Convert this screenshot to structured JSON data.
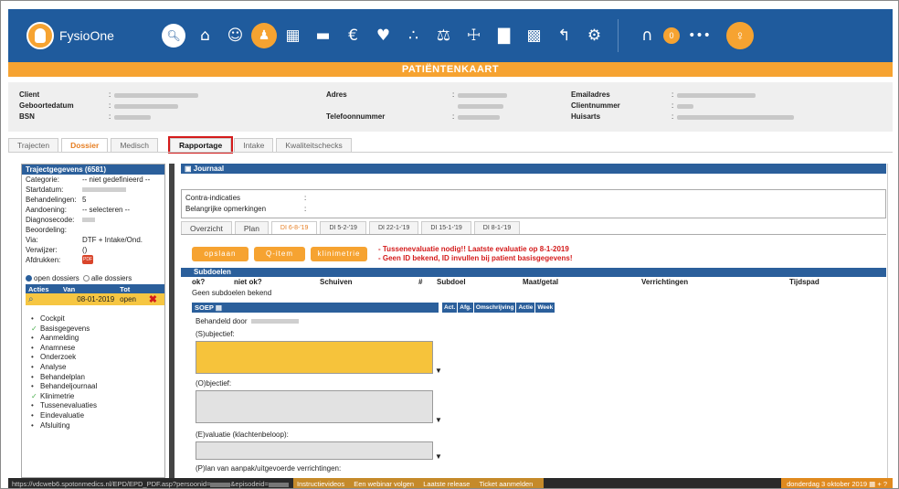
{
  "app": {
    "name": "FysioOne"
  },
  "nav": {
    "icons": [
      "home-icon",
      "client-icon",
      "group-icon",
      "calendar-icon",
      "card-icon",
      "finance-icon",
      "handshake-icon",
      "runner-icon",
      "balance-icon",
      "network-icon",
      "stats-icon",
      "report-icon",
      "back-icon",
      "settings-icon"
    ],
    "support_count": "0",
    "more": "•••"
  },
  "page": {
    "title": "PATIËNTENKAART"
  },
  "patient": {
    "labels": {
      "client": "Client",
      "birthdate": "Geboortedatum",
      "bsn": "BSN",
      "address": "Adres",
      "phone": "Telefoonnummer",
      "email": "Emailadres",
      "client_number": "Clientnummer",
      "gp": "Huisarts"
    }
  },
  "tabs": [
    "Trajecten",
    "Dossier",
    "Medisch",
    "Rapportage",
    "Intake",
    "Kwaliteitschecks"
  ],
  "left": {
    "header": "Trajectgegevens (6581)",
    "rows": [
      {
        "k": "Categorie:",
        "v": "-- niet gedefinieerd --"
      },
      {
        "k": "Startdatum:",
        "v": ""
      },
      {
        "k": "Behandelingen:",
        "v": "5"
      },
      {
        "k": "Aandoening:",
        "v": "-- selecteren --"
      },
      {
        "k": "Diagnosecode:",
        "v": ""
      },
      {
        "k": "Beoordeling:",
        "v": ""
      },
      {
        "k": "Via:",
        "v": "DTF + Intake/Ond."
      },
      {
        "k": "Verwijzer:",
        "v": "()"
      },
      {
        "k": "Afdrukken:",
        "v": ""
      }
    ],
    "pdf_label": "PDF",
    "radio_open": "open dossiers",
    "radio_all": "alle dossiers",
    "table_headers": [
      "Acties",
      "Van",
      "Tot"
    ],
    "table_row": {
      "from": "08-01-2019",
      "to": "open"
    },
    "menu": [
      {
        "label": "Cockpit",
        "check": false
      },
      {
        "label": "Basisgegevens",
        "check": true
      },
      {
        "label": "Aanmelding",
        "check": false
      },
      {
        "label": "Anamnese",
        "check": false
      },
      {
        "label": "Onderzoek",
        "check": false
      },
      {
        "label": "Analyse",
        "check": false
      },
      {
        "label": "Behandelplan",
        "check": false
      },
      {
        "label": "Behandeljournaal",
        "check": false
      },
      {
        "label": "Klinimetrie",
        "check": true
      },
      {
        "label": "Tussenevaluaties",
        "check": false
      },
      {
        "label": "Eindevaluatie",
        "check": false
      },
      {
        "label": "Afsluiting",
        "check": false
      }
    ]
  },
  "journal": {
    "header": "Journaal",
    "contra": "Contra-indicaties",
    "remarks": "Belangrijke opmerkingen",
    "subtabs": [
      "Overzicht",
      "Plan",
      "DI 6-8-'19",
      "DI 5-2-'19",
      "DI 22-1-'19",
      "DI 15-1-'19",
      "DI 8-1-'19"
    ],
    "buttons": [
      "opslaan",
      "Q-item",
      "klinimetrie"
    ],
    "warning1": "- Tussenevaluatie nodig!! Laatste evaluatie op 8-1-2019",
    "warning2": "- Geen ID bekend, ID invullen bij patient basisgegevens!",
    "subgoals_header": "Subdoelen",
    "subgoal_cols": [
      "ok?",
      "niet ok?",
      "Schuiven",
      "#",
      "Subdoel",
      "Maat/getal",
      "Verrichtingen",
      "Tijdspad"
    ],
    "no_subgoals": "Geen subdoelen bekend",
    "soep_header": "SOEP",
    "soep_cols": [
      "Act.",
      "Afg.",
      "Omschrijving",
      "Actie",
      "Week"
    ],
    "treated_by": "Behandeld door",
    "subjective": "(S)ubjectief:",
    "objective": "(O)bjectief:",
    "evaluation": "(E)valuatie (klachtenbeloop):",
    "plan": "(P)lan van aanpak/uitgevoerde verrichtingen:"
  },
  "status": {
    "url_prefix": "https://vdcweb6.spotonmedics.nl/EPD/EPD_PDF.asp?persoonid=",
    "url_mid": "&episodeid=",
    "links": [
      "Instructievideos",
      "Een webinar volgen",
      "Laatste release",
      "Ticket aanmelden"
    ],
    "date": "donderdag 3 oktober 2019"
  },
  "colors": {
    "nav": "#1f5b9d",
    "accent": "#f6a331",
    "highlight": "#d41b1b"
  }
}
